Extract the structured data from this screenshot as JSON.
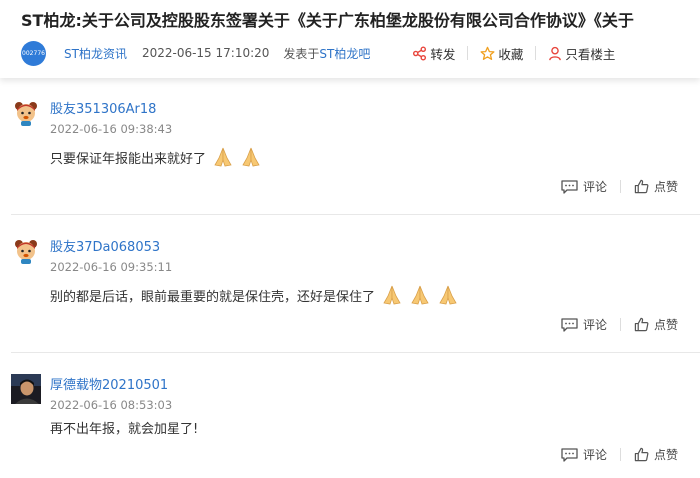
{
  "header": {
    "title": "ST柏龙:关于公司及控股股东签署关于《关于广东柏堡龙股份有限公司合作协议》《关于",
    "stock_code": "002776",
    "author": "ST柏龙资讯",
    "post_time": "2022-06-15 17:10:20",
    "posted_in_prefix": "发表于",
    "posted_in_bar": "ST柏龙吧",
    "share_label": "转发",
    "favorite_label": "收藏",
    "only_author_label": "只看楼主"
  },
  "comments": [
    {
      "user": "股友351306Ar18",
      "time": "2022-06-16 09:38:43",
      "text": "只要保证年报能出来就好了",
      "reply_label": "评论",
      "like_label": "点赞",
      "avatar": "cartoon-avatar",
      "emoji_count": 2
    },
    {
      "user": "股友37Da068053",
      "time": "2022-06-16 09:35:11",
      "text": "别的都是后话，眼前最重要的就是保住壳，还好是保住了",
      "reply_label": "评论",
      "like_label": "点赞",
      "avatar": "cartoon-avatar",
      "emoji_count": 3
    },
    {
      "user": "厚德载物20210501",
      "time": "2022-06-16 08:53:03",
      "text": "再不出年报，就会加星了!",
      "reply_label": "评论",
      "like_label": "点赞",
      "avatar": "photo-avatar",
      "emoji_count": 0
    }
  ],
  "colors": {
    "link_blue": "#2f74c8",
    "stock_avatar_blue": "#2f7bd8",
    "share_icon": "#e8453c",
    "favorite_icon": "#f0a020",
    "only_author_icon": "#e8453c"
  }
}
